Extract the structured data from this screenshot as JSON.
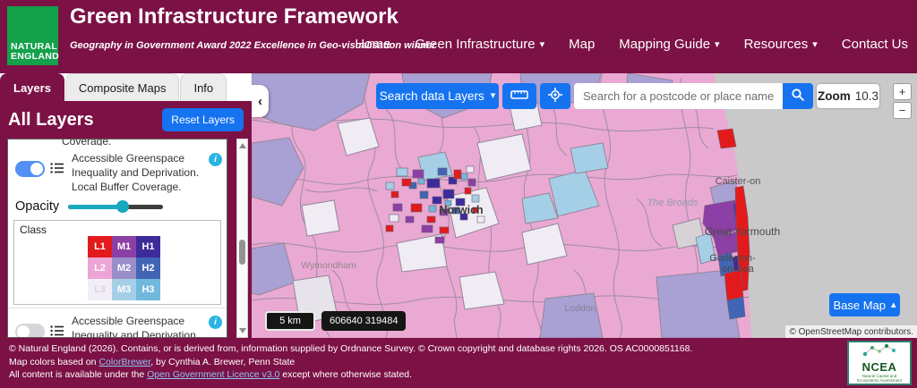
{
  "header": {
    "logo": {
      "line1": "NATURAL",
      "line2": "ENGLAND"
    },
    "title": "Green Infrastructure Framework",
    "subtitle": "Geography in Government Award 2022 Excellence in Geo-visualisation winner",
    "nav": [
      {
        "label": "Home",
        "dropdown": false
      },
      {
        "label": "Green Infrastructure",
        "dropdown": true
      },
      {
        "label": "Map",
        "dropdown": false
      },
      {
        "label": "Mapping Guide",
        "dropdown": true
      },
      {
        "label": "Resources",
        "dropdown": true
      },
      {
        "label": "Contact Us",
        "dropdown": false
      }
    ]
  },
  "panel": {
    "tabs": [
      {
        "label": "Layers",
        "active": true
      },
      {
        "label": "Composite Maps",
        "active": false
      },
      {
        "label": "Info",
        "active": false
      }
    ],
    "heading": "All Layers",
    "reset_button": "Reset Layers",
    "clipped_line": "Coverage.",
    "layers": [
      {
        "name": "Accessible Greenspace Inequality and Deprivation. Local Buffer Coverage.",
        "enabled": true
      },
      {
        "name": "Accessible Greenspace Inequality and Deprivation. Neighbourhood Buffer Coverage.",
        "enabled": false
      }
    ],
    "opacity": {
      "label": "Opacity",
      "value_pct": 57
    },
    "class_legend": {
      "label": "Class",
      "cells": [
        {
          "label": "L1",
          "color": "#e31a1c",
          "text_color": "#ffffff"
        },
        {
          "label": "M1",
          "color": "#8c3fa5",
          "text_color": "#ffffff"
        },
        {
          "label": "H1",
          "color": "#3d2b9b",
          "text_color": "#ffffff"
        },
        {
          "label": "L2",
          "color": "#eda4d6",
          "text_color": "#ffffff"
        },
        {
          "label": "M2",
          "color": "#9a8ec9",
          "text_color": "#ffffff"
        },
        {
          "label": "H2",
          "color": "#4165b5",
          "text_color": "#ffffff"
        },
        {
          "label": "L3",
          "color": "#f2eef7",
          "text_color": "#d9d2e6"
        },
        {
          "label": "M3",
          "color": "#a5cfe6",
          "text_color": "#ffffff"
        },
        {
          "label": "H3",
          "color": "#70b9dc",
          "text_color": "#ffffff"
        }
      ]
    }
  },
  "map": {
    "toolbar": {
      "search_layers": "Search data Layers",
      "search_placeholder": "Search for a postcode or place name",
      "zoom_label": "Zoom",
      "zoom_value": "10.3",
      "zoom_in": "+",
      "zoom_out": "−"
    },
    "collapse_glyph": "‹",
    "scale_bar": "5 km",
    "coordinates": "606640 319484",
    "base_map_button": "Base Map",
    "attribution": "© OpenStreetMap contributors.",
    "place_labels": {
      "norwich": "Norwich",
      "caister": "Caister-on",
      "great_yarmouth": "Great Yarmouth",
      "gorleston1": "Gorleston-",
      "gorleston2": "on-Sea",
      "broads": "The Broads",
      "wymondham": "Wymondham",
      "loddon": "Loddon"
    }
  },
  "footer": {
    "line1": "© Natural England (2026). Contains, or is derived from, information supplied by Ordnance Survey. © Crown copyright and database rights 2026. OS AC0000851168.",
    "line2_prefix": "Map colors based on ",
    "line2_link": "ColorBrewer",
    "line2_suffix": ", by Cynthia A. Brewer, Penn State",
    "line3_prefix": "All content is available under the ",
    "line3_link": "Open Government Licence v3.0",
    "line3_suffix": " except where otherwise stated.",
    "ncea_logo": {
      "acronym": "NCEA",
      "name": "Natural Capital and Ecosystems Assessment"
    }
  },
  "colors": {
    "brand_crimson": "#7c1145",
    "logo_green": "#14a14b",
    "button_blue": "#1673f0",
    "info_cyan": "#2ab4e4",
    "slider_teal": "#17a9bd",
    "map_base_pink": "#e9a9d2",
    "map_lavender": "#a9a0d4",
    "sea_gray": "#c9c9c9"
  }
}
